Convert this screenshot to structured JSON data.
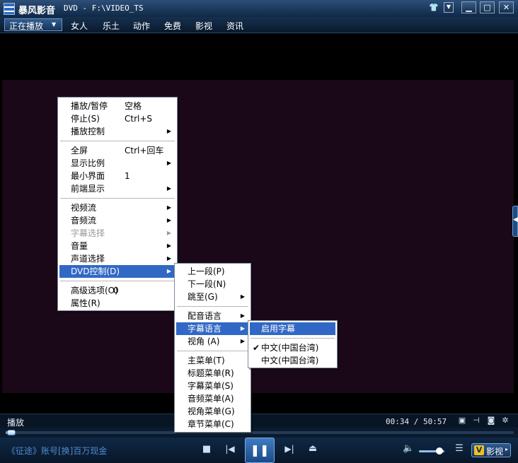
{
  "title_bar": {
    "app_name": "暴风影音",
    "document": "DVD - F:\\VIDEO_TS"
  },
  "nav": {
    "active": "正在播放",
    "tabs": [
      "女人",
      "乐土",
      "动作",
      "免费",
      "影视",
      "资讯"
    ]
  },
  "main_menu": {
    "items": [
      {
        "label": "播放/暂停",
        "shortcut": "空格"
      },
      {
        "label": "停止(S)",
        "shortcut": "Ctrl+S"
      },
      {
        "label": "播放控制"
      },
      {
        "label": "全屏",
        "shortcut": "Ctrl+回车"
      },
      {
        "label": "显示比例"
      },
      {
        "label": "最小界面",
        "shortcut": "1"
      },
      {
        "label": "前端显示"
      },
      {
        "label": "视频流"
      },
      {
        "label": "音频流"
      },
      {
        "label": "字幕选择"
      },
      {
        "label": "音量"
      },
      {
        "label": "声道选择"
      },
      {
        "label": "DVD控制(D)"
      },
      {
        "label": "高级选项(O)",
        "shortcut": "0"
      },
      {
        "label": "属性(R)"
      }
    ]
  },
  "dvd_menu": {
    "items": [
      {
        "label": "上一段(P)"
      },
      {
        "label": "下一段(N)"
      },
      {
        "label": "跳至(G)"
      },
      {
        "label": "配音语言"
      },
      {
        "label": "字幕语言"
      },
      {
        "label": "视角 (A)"
      },
      {
        "label": "主菜单(T)"
      },
      {
        "label": "标题菜单(R)"
      },
      {
        "label": "字幕菜单(S)"
      },
      {
        "label": "音频菜单(A)"
      },
      {
        "label": "视角菜单(G)"
      },
      {
        "label": "章节菜单(C)"
      }
    ]
  },
  "subtitle_menu": {
    "items": [
      {
        "label": "启用字幕"
      },
      {
        "label": "中文(中国台湾)"
      },
      {
        "label": "中文(中国台湾)"
      }
    ]
  },
  "status": {
    "state": "播放",
    "elapsed": "00:34",
    "separator": "/",
    "total": "50:57"
  },
  "progress": {
    "fraction": 0.011
  },
  "volume": {
    "fraction": 0.8
  },
  "controls": {
    "ad_text": "《征途》账号[换]百万现金",
    "yingshi_logo": "V",
    "yingshi_label": "影视"
  },
  "colors": {
    "highlight": "#3168c5",
    "video_bg": "#1a0818",
    "chrome_blue": "#153158"
  }
}
